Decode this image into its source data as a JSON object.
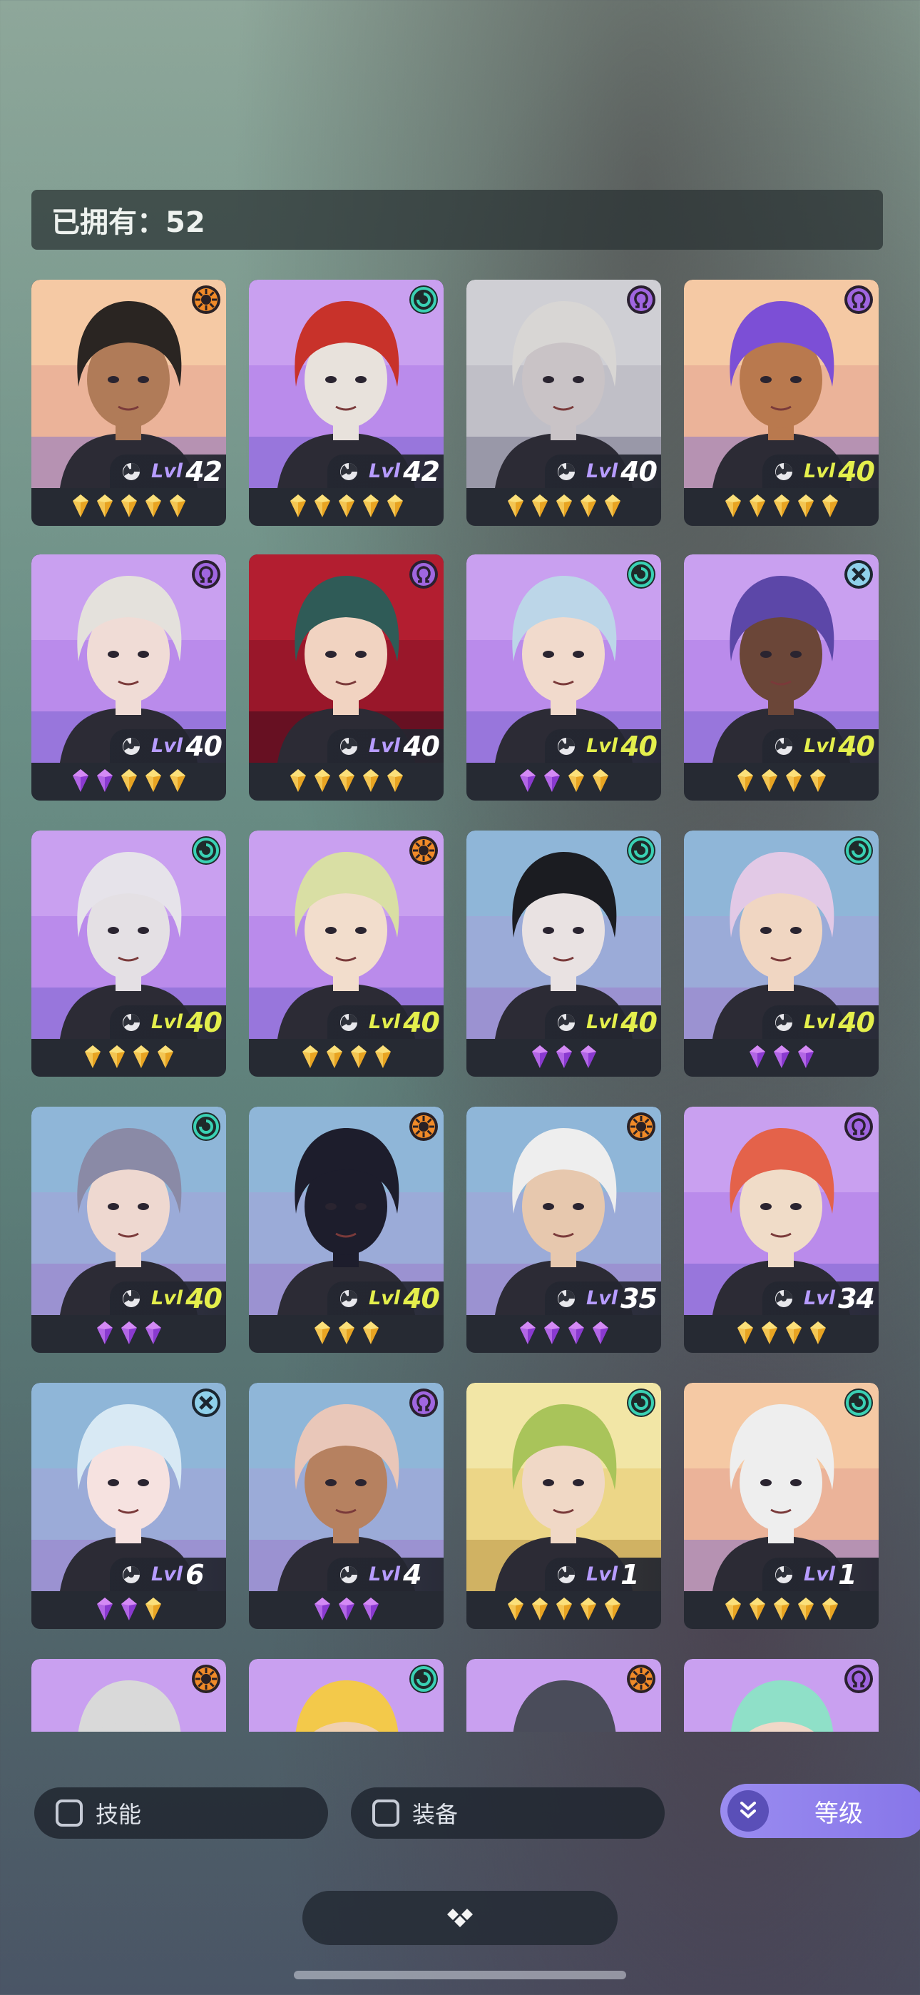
{
  "header": {
    "owned_label": "已拥有：52"
  },
  "colors": {
    "gold_gem": "#f5c33b",
    "purple_gem": "#b35ae8",
    "lv_yellow": "#e8f04a",
    "lv_white": "#ffffff",
    "lv_purple": "#b79cff",
    "accent": "#8776e9"
  },
  "heroes": [
    {
      "faction": "sun-icon",
      "level": "42",
      "lvl_label": "Lvl",
      "level_color": "white",
      "gems": [
        "gold",
        "gold",
        "gold",
        "gold",
        "gold"
      ],
      "bg": "peach",
      "hair": "#2a2522",
      "skin": "#b07b58"
    },
    {
      "faction": "swirl-icon",
      "level": "42",
      "lvl_label": "Lvl",
      "level_color": "white",
      "gems": [
        "gold",
        "gold",
        "gold",
        "gold",
        "gold"
      ],
      "bg": "purple",
      "hair": "#c8322a",
      "skin": "#e8e2dc"
    },
    {
      "faction": "omega-icon",
      "level": "40",
      "lvl_label": "Lvl",
      "level_color": "white",
      "gems": [
        "gold",
        "gold",
        "gold",
        "gold",
        "gold"
      ],
      "bg": "grey",
      "hair": "#d8d6d4",
      "skin": "#c9c3c6"
    },
    {
      "faction": "omega-icon",
      "level": "40",
      "lvl_label": "Lvl",
      "level_color": "yellow",
      "gems": [
        "gold",
        "gold",
        "gold",
        "gold",
        "gold"
      ],
      "bg": "peach",
      "hair": "#7c4fd6",
      "skin": "#b9794e"
    },
    {
      "faction": "omega-icon",
      "level": "40",
      "lvl_label": "Lvl",
      "level_color": "white",
      "gems": [
        "purple",
        "purple",
        "gold",
        "gold",
        "gold"
      ],
      "bg": "purple",
      "hair": "#e4e1dc",
      "skin": "#f0dcd6"
    },
    {
      "faction": "omega-icon",
      "level": "40",
      "lvl_label": "Lvl",
      "level_color": "white",
      "gems": [
        "gold",
        "gold",
        "gold",
        "gold",
        "gold"
      ],
      "bg": "red",
      "hair": "#2f5b57",
      "skin": "#f1d3c1"
    },
    {
      "faction": "swirl-icon",
      "level": "40",
      "lvl_label": "Lvl",
      "level_color": "yellow",
      "gems": [
        "purple",
        "purple",
        "gold",
        "gold"
      ],
      "bg": "purple",
      "hair": "#bcd6e8",
      "skin": "#f1dacc"
    },
    {
      "faction": "cross-icon",
      "level": "40",
      "lvl_label": "Lvl",
      "level_color": "yellow",
      "gems": [
        "gold",
        "gold",
        "gold",
        "gold"
      ],
      "bg": "purple",
      "hair": "#5c47a8",
      "skin": "#6b4638"
    },
    {
      "faction": "swirl-icon",
      "level": "40",
      "lvl_label": "Lvl",
      "level_color": "yellow",
      "gems": [
        "gold",
        "gold",
        "gold",
        "gold"
      ],
      "bg": "purple",
      "hair": "#e6e3ea",
      "skin": "#e4e0e4"
    },
    {
      "faction": "sun-icon",
      "level": "40",
      "lvl_label": "Lvl",
      "level_color": "yellow",
      "gems": [
        "gold",
        "gold",
        "gold",
        "gold"
      ],
      "bg": "purple",
      "hair": "#d9dfa4",
      "skin": "#f2ddcc"
    },
    {
      "faction": "swirl-icon",
      "level": "40",
      "lvl_label": "Lvl",
      "level_color": "yellow",
      "gems": [
        "purple",
        "purple",
        "purple"
      ],
      "bg": "blue",
      "hair": "#1b1c21",
      "skin": "#e9e2e2"
    },
    {
      "faction": "swirl-icon",
      "level": "40",
      "lvl_label": "Lvl",
      "level_color": "yellow",
      "gems": [
        "purple",
        "purple",
        "purple"
      ],
      "bg": "blue",
      "hair": "#e2c9e6",
      "skin": "#f0d6c2"
    },
    {
      "faction": "swirl-icon",
      "level": "40",
      "lvl_label": "Lvl",
      "level_color": "yellow",
      "gems": [
        "purple",
        "purple",
        "purple"
      ],
      "bg": "blue",
      "hair": "#8a8aa6",
      "skin": "#eed8d0"
    },
    {
      "faction": "sun-icon",
      "level": "40",
      "lvl_label": "Lvl",
      "level_color": "yellow",
      "gems": [
        "gold",
        "gold",
        "gold"
      ],
      "bg": "blue",
      "hair": "#1d1d2c",
      "skin": "#1d1d2c"
    },
    {
      "faction": "sun-icon",
      "level": "35",
      "lvl_label": "Lvl",
      "level_color": "white",
      "gems": [
        "purple",
        "purple",
        "purple",
        "purple"
      ],
      "bg": "blue",
      "hair": "#eeeeee",
      "skin": "#e7c8ae"
    },
    {
      "faction": "omega-icon",
      "level": "34",
      "lvl_label": "Lvl",
      "level_color": "white",
      "gems": [
        "gold",
        "gold",
        "gold",
        "gold"
      ],
      "bg": "purple",
      "hair": "#e4624a",
      "skin": "#f0dcc8"
    },
    {
      "faction": "cross-icon",
      "level": "6",
      "lvl_label": "Lvl",
      "level_color": "white",
      "gems": [
        "purple",
        "purple",
        "gold"
      ],
      "bg": "blue",
      "hair": "#d8e9f4",
      "skin": "#f6e2e0"
    },
    {
      "faction": "omega-icon",
      "level": "4",
      "lvl_label": "Lvl",
      "level_color": "white",
      "gems": [
        "purple",
        "purple",
        "purple"
      ],
      "bg": "blue",
      "hair": "#e9c7b9",
      "skin": "#b68160"
    },
    {
      "faction": "swirl-icon",
      "level": "1",
      "lvl_label": "Lvl",
      "level_color": "white",
      "gems": [
        "gold",
        "gold",
        "gold",
        "gold",
        "gold"
      ],
      "bg": "yellow",
      "hair": "#a9c45a",
      "skin": "#f0d8c6"
    },
    {
      "faction": "swirl-icon",
      "level": "1",
      "lvl_label": "Lvl",
      "level_color": "white",
      "gems": [
        "gold",
        "gold",
        "gold",
        "gold",
        "gold"
      ],
      "bg": "peach",
      "hair": "#eeeeee",
      "skin": "#eeeeee"
    },
    {
      "faction": "sun-icon",
      "level": "",
      "lvl_label": "",
      "level_color": "white",
      "gems": [],
      "bg": "purple",
      "hair": "#d9d9d9",
      "skin": "#d9d9d9"
    },
    {
      "faction": "swirl-icon",
      "level": "",
      "lvl_label": "",
      "level_color": "white",
      "gems": [],
      "bg": "purple",
      "hair": "#f3c94a",
      "skin": "#f0d0b0"
    },
    {
      "faction": "sun-icon",
      "level": "",
      "lvl_label": "",
      "level_color": "white",
      "gems": [],
      "bg": "purple",
      "hair": "#4a4c5a",
      "skin": "#4a4c5a"
    },
    {
      "faction": "omega-icon",
      "level": "",
      "lvl_label": "",
      "level_color": "white",
      "gems": [],
      "bg": "purple",
      "hair": "#8fe0c8",
      "skin": "#f0d8c8"
    }
  ],
  "filters": {
    "skill_label": "技能",
    "equip_label": "装备",
    "sort_label": "等级"
  }
}
